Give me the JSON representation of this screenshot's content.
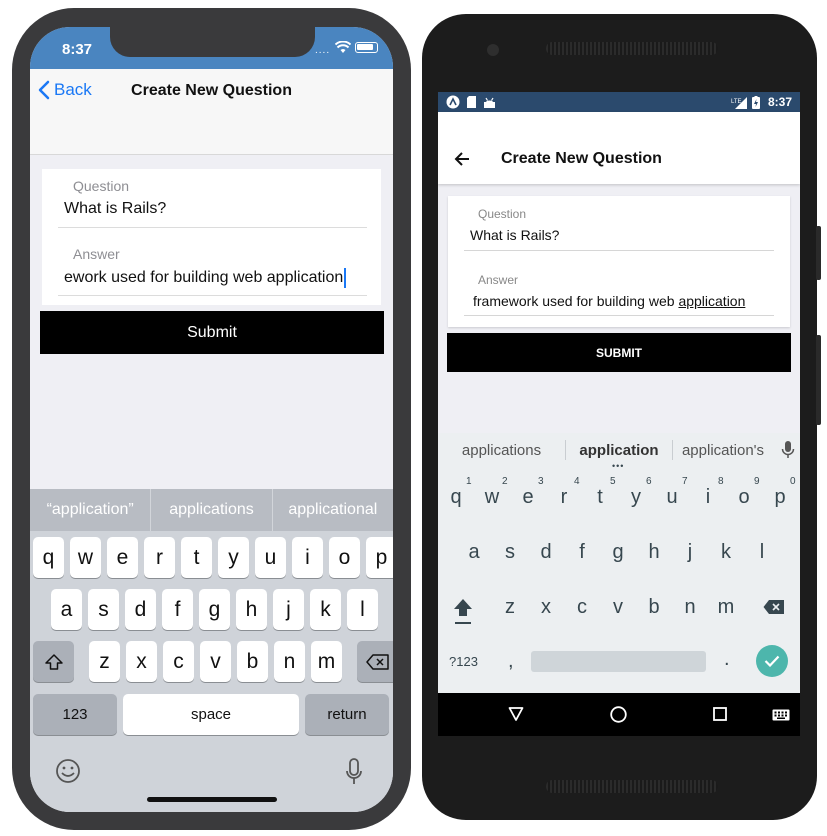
{
  "ios": {
    "status": {
      "time": "8:37"
    },
    "nav": {
      "back": "Back",
      "title": "Create New Question"
    },
    "form": {
      "question_label": "Question",
      "question_value": "What is Rails?",
      "answer_label": "Answer",
      "answer_value": "ework used for building web application"
    },
    "submit": "Submit",
    "suggestions": [
      "“application”",
      "applications",
      "applicational"
    ],
    "keyboard": {
      "row1": [
        "q",
        "w",
        "e",
        "r",
        "t",
        "y",
        "u",
        "i",
        "o",
        "p"
      ],
      "row2": [
        "a",
        "s",
        "d",
        "f",
        "g",
        "h",
        "j",
        "k",
        "l"
      ],
      "row3": [
        "z",
        "x",
        "c",
        "v",
        "b",
        "n",
        "m"
      ],
      "numbers_key": "123",
      "space_key": "space",
      "return_key": "return"
    }
  },
  "android": {
    "status": {
      "time": "8:37"
    },
    "toolbar": {
      "title": "Create New Question"
    },
    "form": {
      "question_label": "Question",
      "question_value": "What is Rails?",
      "answer_label": "Answer",
      "answer_prefix": "framework used for building web ",
      "answer_underlined": "application"
    },
    "submit": "SUBMIT",
    "suggestions": [
      "applications",
      "application",
      "application's"
    ],
    "keyboard": {
      "row1": [
        "q",
        "w",
        "e",
        "r",
        "t",
        "y",
        "u",
        "i",
        "o",
        "p"
      ],
      "row1_numbers": [
        "1",
        "2",
        "3",
        "4",
        "5",
        "6",
        "7",
        "8",
        "9",
        "0"
      ],
      "row2": [
        "a",
        "s",
        "d",
        "f",
        "g",
        "h",
        "j",
        "k",
        "l"
      ],
      "row3": [
        "z",
        "x",
        "c",
        "v",
        "b",
        "n",
        "m"
      ],
      "symbols_key": "?123",
      "comma_key": ",",
      "period_key": "."
    },
    "accent_color": "#4db6ac"
  }
}
